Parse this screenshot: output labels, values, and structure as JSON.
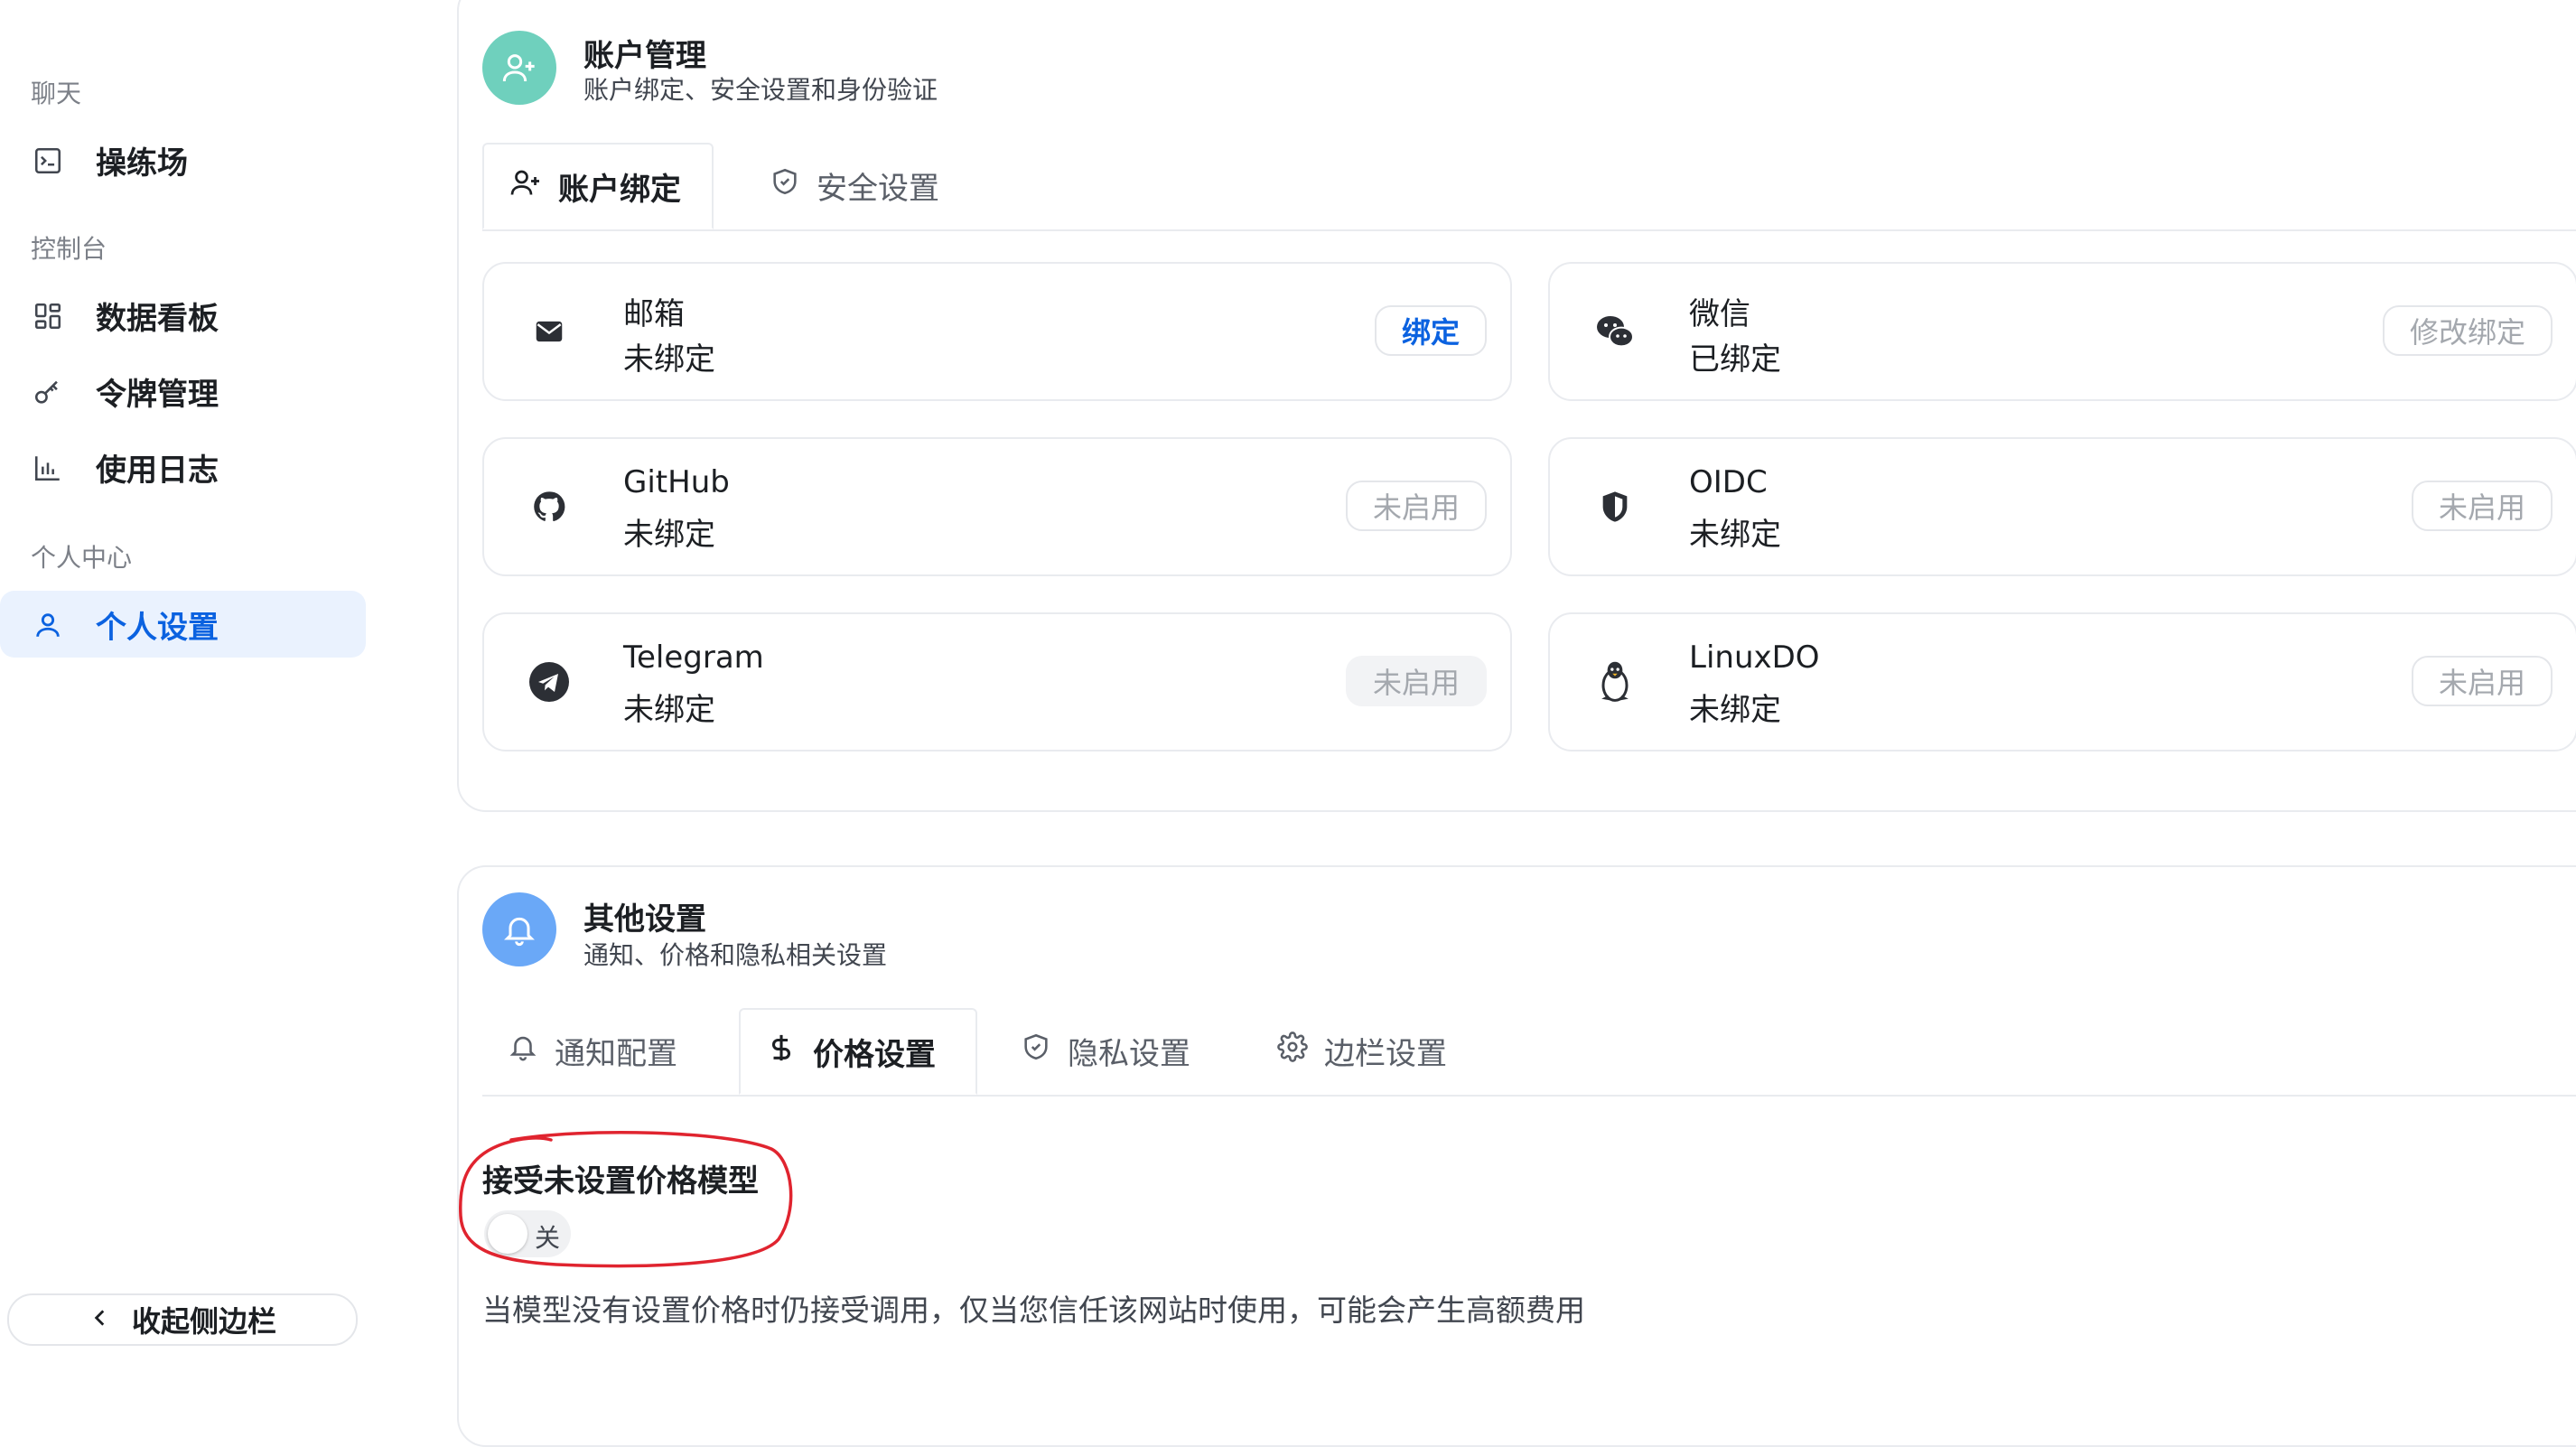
{
  "sidebar": {
    "sections": [
      {
        "label": "聊天"
      },
      {
        "label": "控制台"
      },
      {
        "label": "个人中心"
      }
    ],
    "items": [
      {
        "label": "操练场",
        "icon": "terminal-icon"
      },
      {
        "label": "数据看板",
        "icon": "dashboard-icon"
      },
      {
        "label": "令牌管理",
        "icon": "key-icon"
      },
      {
        "label": "使用日志",
        "icon": "bar-chart-icon"
      },
      {
        "label": "个人设置",
        "icon": "user-icon",
        "active": true
      }
    ],
    "collapse_label": "收起侧边栏"
  },
  "account_card": {
    "title": "账户管理",
    "subtitle": "账户绑定、安全设置和身份验证",
    "icon_color": "#6fd0bd",
    "tabs": [
      {
        "label": "账户绑定",
        "icon": "user-plus-icon",
        "active": true
      },
      {
        "label": "安全设置",
        "icon": "shield-check-icon",
        "active": false
      }
    ],
    "bindings": [
      {
        "name": "邮箱",
        "status": "未绑定",
        "button": "绑定",
        "icon": "mail-icon"
      },
      {
        "name": "微信",
        "status": "已绑定",
        "button": "修改绑定",
        "icon": "wechat-icon"
      },
      {
        "name": "GitHub",
        "status": "未绑定",
        "button": "未启用",
        "icon": "github-icon"
      },
      {
        "name": "OIDC",
        "status": "未绑定",
        "button": "未启用",
        "icon": "oidc-shield-icon"
      },
      {
        "name": "Telegram",
        "status": "未绑定",
        "button": "未启用",
        "icon": "telegram-icon"
      },
      {
        "name": "LinuxDO",
        "status": "未绑定",
        "button": "未启用",
        "icon": "linux-penguin-icon"
      }
    ]
  },
  "other_card": {
    "title": "其他设置",
    "subtitle": "通知、价格和隐私相关设置",
    "icon_color": "#6aa8f7",
    "tabs": [
      {
        "label": "通知配置",
        "icon": "bell-icon",
        "active": false
      },
      {
        "label": "价格设置",
        "icon": "dollar-icon",
        "active": true
      },
      {
        "label": "隐私设置",
        "icon": "shield-check-icon",
        "active": false
      },
      {
        "label": "边栏设置",
        "icon": "gear-icon",
        "active": false
      }
    ],
    "setting": {
      "label": "接受未设置价格模型",
      "toggle_state": "关",
      "toggle_on": false,
      "description": "当模型没有设置价格时仍接受调用，仅当您信任该网站时使用，可能会产生高额费用"
    }
  },
  "colors": {
    "accent": "#0b62e0",
    "active_nav_bg": "#eaf2fe",
    "annotation": "#e0242f"
  }
}
